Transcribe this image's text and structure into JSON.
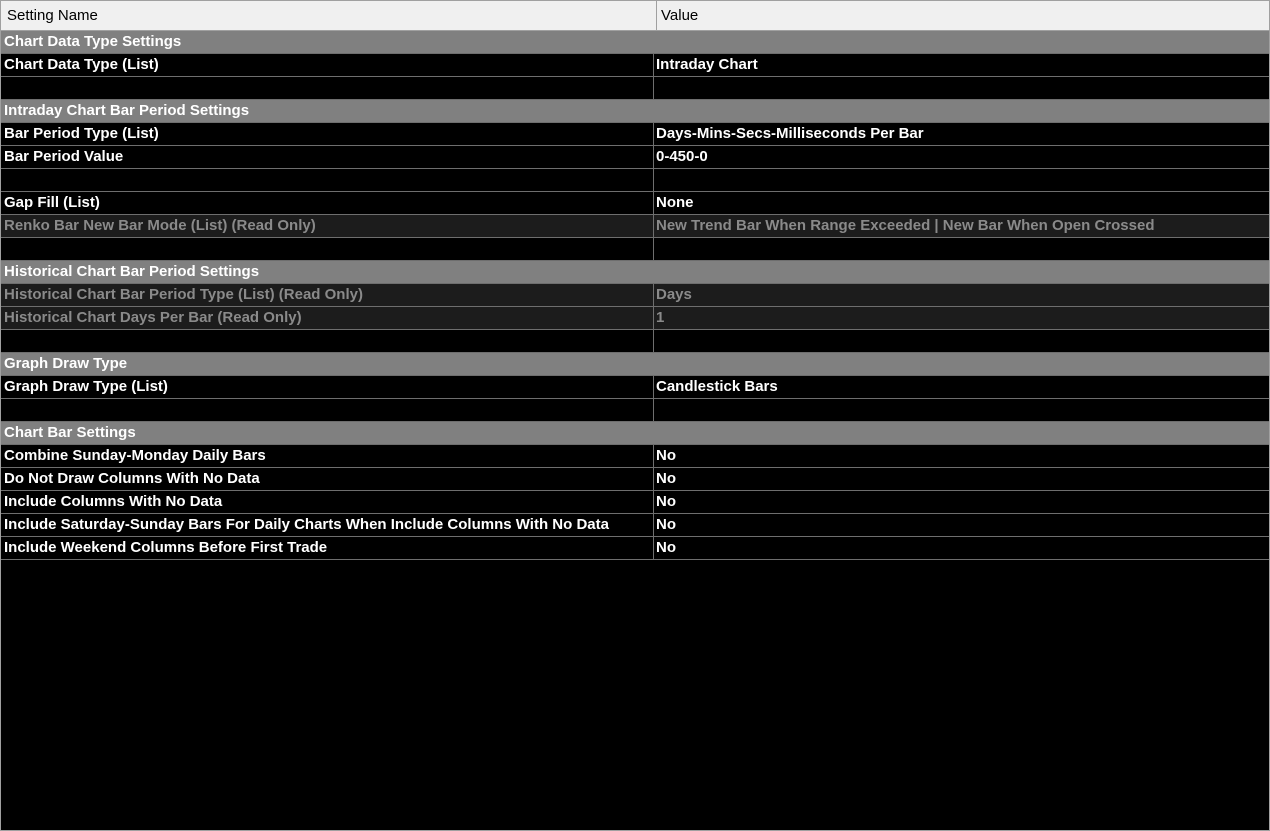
{
  "header": {
    "name_col": "Setting Name",
    "value_col": "Value"
  },
  "rows": [
    {
      "type": "section",
      "name": "Chart Data Type Settings"
    },
    {
      "type": "setting",
      "name": "Chart Data Type (List)",
      "value": "Intraday Chart"
    },
    {
      "type": "blank"
    },
    {
      "type": "section",
      "name": "Intraday Chart Bar Period Settings"
    },
    {
      "type": "setting",
      "name": "Bar Period Type (List)",
      "value": "Days-Mins-Secs-Milliseconds Per Bar"
    },
    {
      "type": "setting",
      "name": "Bar Period Value",
      "value": "0-450-0"
    },
    {
      "type": "blank"
    },
    {
      "type": "setting",
      "name": "Gap Fill (List)",
      "value": "None"
    },
    {
      "type": "readonly",
      "name": "Renko Bar New Bar Mode (List) (Read Only)",
      "value": "New Trend Bar When Range Exceeded | New Bar When Open Crossed"
    },
    {
      "type": "blank"
    },
    {
      "type": "section",
      "name": "Historical Chart Bar Period Settings"
    },
    {
      "type": "readonly",
      "name": "Historical Chart Bar Period Type (List) (Read Only)",
      "value": "Days"
    },
    {
      "type": "readonly",
      "name": "Historical Chart Days Per Bar (Read Only)",
      "value": "1"
    },
    {
      "type": "blank"
    },
    {
      "type": "section",
      "name": "Graph Draw Type"
    },
    {
      "type": "setting",
      "name": "Graph Draw Type (List)",
      "value": "Candlestick Bars"
    },
    {
      "type": "blank"
    },
    {
      "type": "section",
      "name": "Chart Bar Settings"
    },
    {
      "type": "setting",
      "name": "Combine Sunday-Monday Daily Bars",
      "value": "No"
    },
    {
      "type": "setting",
      "name": "Do Not Draw Columns With No Data",
      "value": "No"
    },
    {
      "type": "setting",
      "name": "Include Columns With No Data",
      "value": "No"
    },
    {
      "type": "setting",
      "name": "Include Saturday-Sunday Bars For Daily Charts When Include Columns With No Data",
      "value": "No"
    },
    {
      "type": "setting",
      "name": "Include Weekend Columns Before First Trade",
      "value": "No"
    }
  ]
}
